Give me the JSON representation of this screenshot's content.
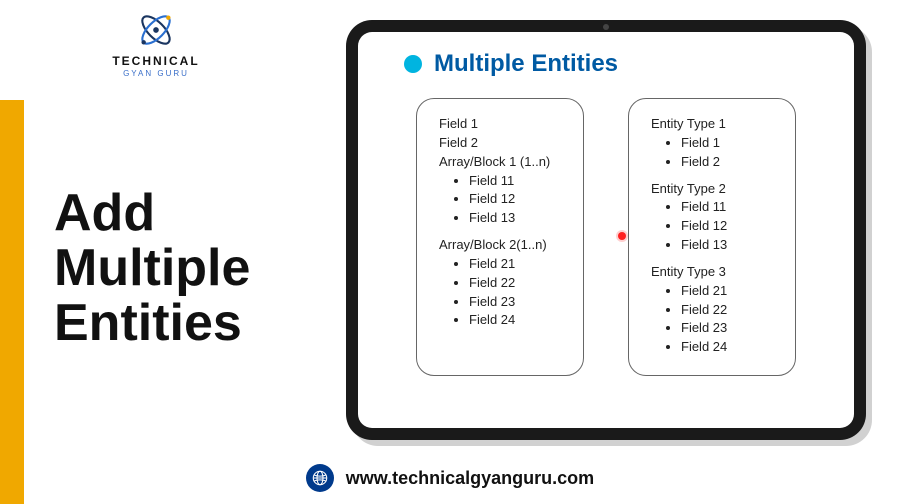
{
  "logo": {
    "main": "TECHNICAL",
    "sub": "GYAN GURU"
  },
  "heading": {
    "line1": "Add",
    "line2": "Multiple",
    "line3": "Entities"
  },
  "slide": {
    "title": "Multiple Entities",
    "leftBox": {
      "f1": "Field 1",
      "f2": "Field 2",
      "block1": "Array/Block 1 (1..n)",
      "b1f1": "Field 11",
      "b1f2": "Field 12",
      "b1f3": "Field 13",
      "block2": "Array/Block 2(1..n)",
      "b2f1": "Field 21",
      "b2f2": "Field 22",
      "b2f3": "Field 23",
      "b2f4": "Field 24"
    },
    "rightBox": {
      "e1": "Entity Type 1",
      "e1f1": "Field 1",
      "e1f2": "Field 2",
      "e2": "Entity Type 2",
      "e2f1": "Field 11",
      "e2f2": "Field 12",
      "e2f3": "Field 13",
      "e3": "Entity Type 3",
      "e3f1": "Field 21",
      "e3f2": "Field 22",
      "e3f3": "Field 23",
      "e3f4": "Field 24"
    }
  },
  "footer": {
    "url": "www.technicalgyanguru.com"
  }
}
